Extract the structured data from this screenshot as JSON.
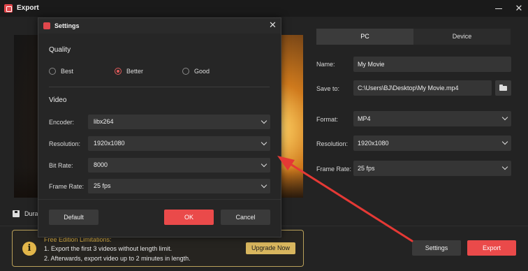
{
  "window": {
    "title": "Export"
  },
  "preview": {
    "duration_label": "Dura"
  },
  "tabs": [
    {
      "label": "PC",
      "active": true
    },
    {
      "label": "Device",
      "active": false
    }
  ],
  "output": {
    "name_label": "Name:",
    "name_value": "My Movie",
    "save_label": "Save to:",
    "save_value": "C:\\Users\\BJ\\Desktop\\My Movie.mp4",
    "format_label": "Format:",
    "format_value": "MP4",
    "resolution_label": "Resolution:",
    "resolution_value": "1920x1080",
    "framerate_label": "Frame Rate:",
    "framerate_value": "25 fps"
  },
  "limitations": {
    "title": "Free Edition Limitations:",
    "line1": "1. Export the first 3 videos without length limit.",
    "line2": "2. Afterwards, export video up to 2 minutes in length.",
    "upgrade_label": "Upgrade Now"
  },
  "footer": {
    "settings_label": "Settings",
    "export_label": "Export"
  },
  "dialog": {
    "title": "Settings",
    "quality_title": "Quality",
    "quality_options": [
      {
        "label": "Best",
        "checked": false
      },
      {
        "label": "Better",
        "checked": true
      },
      {
        "label": "Good",
        "checked": false
      }
    ],
    "video_title": "Video",
    "encoder_label": "Encoder:",
    "encoder_value": "libx264",
    "resolution_label": "Resolution:",
    "resolution_value": "1920x1080",
    "bitrate_label": "Bit Rate:",
    "bitrate_value": "8000",
    "framerate_label": "Frame Rate:",
    "framerate_value": "25 fps",
    "default_label": "Default",
    "ok_label": "OK",
    "cancel_label": "Cancel"
  },
  "colors": {
    "accent": "#ea4a4a",
    "warning": "#e2b64a",
    "annotation": "#e53935"
  }
}
